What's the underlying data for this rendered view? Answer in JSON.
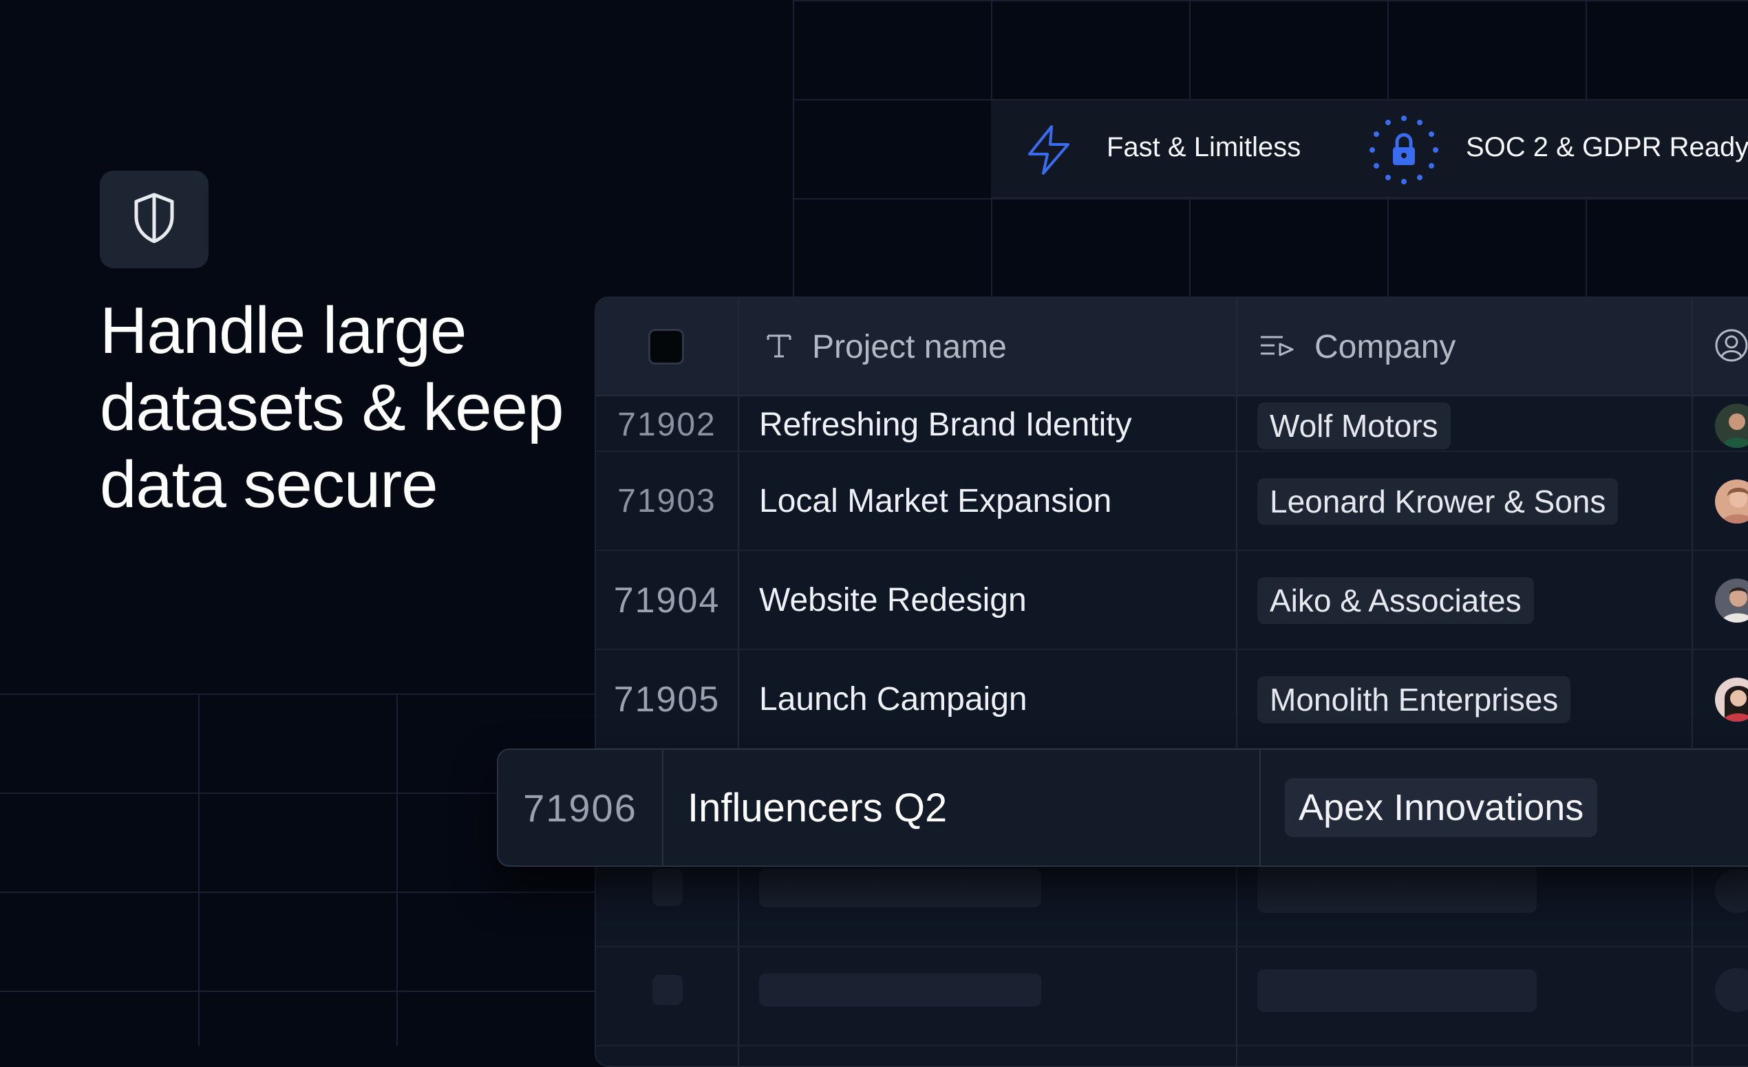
{
  "features": {
    "fast": {
      "label": "Fast & Limitless",
      "icon": "lightning-icon"
    },
    "compliance": {
      "label": "SOC 2 & GDPR Ready",
      "icon": "eu-lock-icon"
    }
  },
  "hero": {
    "icon": "shield-icon",
    "headline": [
      "Handle large",
      "datasets & keep",
      "data secure"
    ]
  },
  "table": {
    "columns": [
      {
        "label": "Project name",
        "icon": "text-type-icon"
      },
      {
        "label": "Company",
        "icon": "list-select-icon"
      },
      {
        "label": "",
        "icon": "user-circle-icon"
      }
    ],
    "rows": [
      {
        "id": "71902",
        "name": "Refreshing Brand Identity",
        "company": "Wolf Motors"
      },
      {
        "id": "71903",
        "name": "Local Market Expansion",
        "company": "Leonard Krower & Sons"
      },
      {
        "id": "71904",
        "name": "Website Redesign",
        "company": "Aiko & Associates"
      },
      {
        "id": "71905",
        "name": "Launch Campaign",
        "company": "Monolith Enterprises"
      }
    ],
    "highlighted_row": {
      "id": "71906",
      "name": "Influencers Q2",
      "company": "Apex Innovations"
    }
  },
  "colors": {
    "background": "#050913",
    "accent_blue": "#3a6cf0",
    "card": "#0f1624"
  }
}
